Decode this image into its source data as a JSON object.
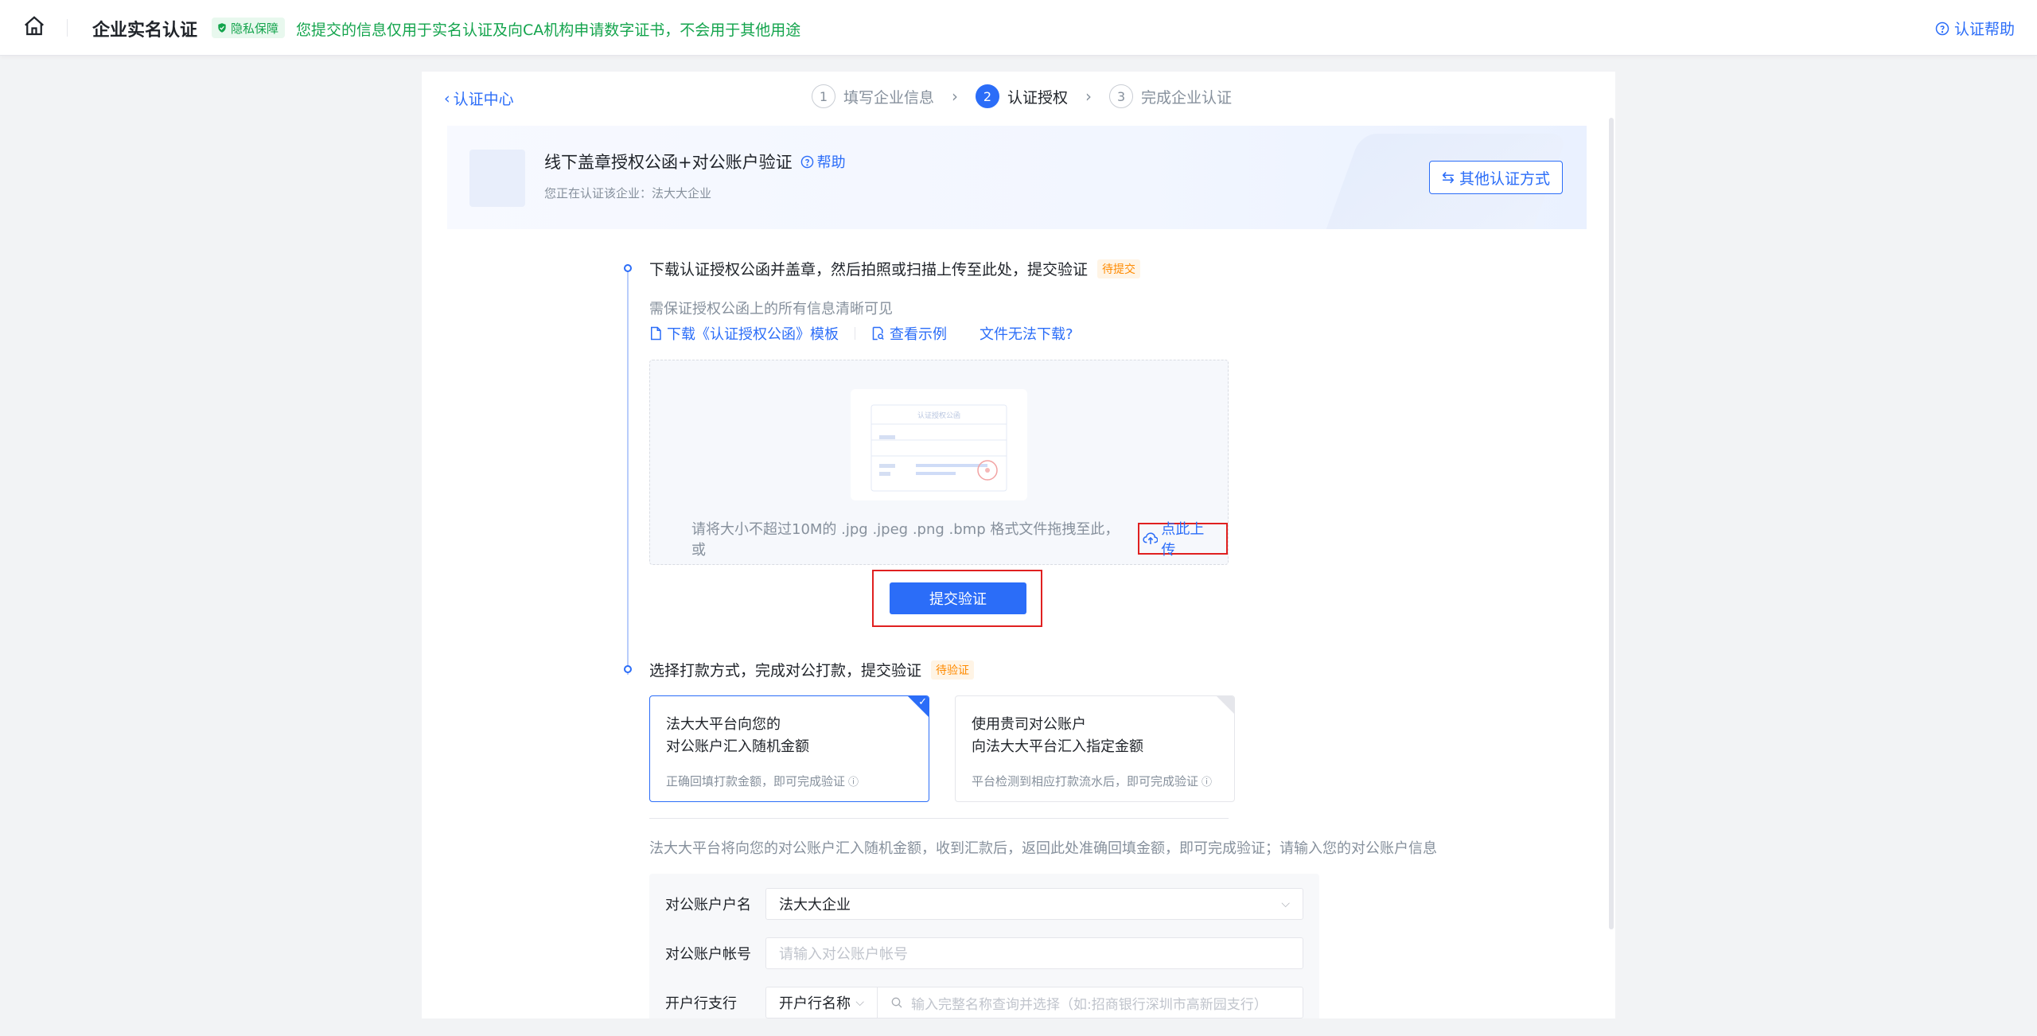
{
  "header": {
    "title": "企业实名认证",
    "privacy_badge": "隐私保障",
    "privacy_text": "您提交的信息仅用于实名认证及向CA机构申请数字证书，不会用于其他用途",
    "help_label": "认证帮助"
  },
  "nav": {
    "back_label": "认证中心",
    "steps": [
      {
        "num": "1",
        "label": "填写企业信息"
      },
      {
        "num": "2",
        "label": "认证授权"
      },
      {
        "num": "3",
        "label": "完成企业认证"
      }
    ]
  },
  "banner": {
    "title": "线下盖章授权公函+对公账户验证",
    "help_label": "帮助",
    "subtitle": "您正在认证该企业：法大大企业",
    "other_method_label": "其他认证方式"
  },
  "step1": {
    "title": "下载认证授权公函并盖章，然后拍照或扫描上传至此处，提交验证",
    "tag": "待提交",
    "hint": "需保证授权公函上的所有信息清晰可见",
    "link_download": "下载《认证授权公函》模板",
    "link_example": "查看示例",
    "link_cannot_download": "文件无法下载?",
    "doc_preview_title": "认证授权公函",
    "upload_tip": "请将大小不超过10M的 .jpg .jpeg .png .bmp 格式文件拖拽至此，或",
    "upload_label": "点此上传",
    "submit_label": "提交验证"
  },
  "step2": {
    "title": "选择打款方式，完成对公打款，提交验证",
    "tag": "待验证",
    "option_a": {
      "line1": "法大大平台向您的",
      "line2": "对公账户汇入随机金额",
      "sub": "正确回填打款金额，即可完成验证"
    },
    "option_b": {
      "line1": "使用贵司对公账户",
      "line2": "向法大大平台汇入指定金额",
      "sub": "平台检测到相应打款流水后，即可完成验证"
    },
    "description": "法大大平台将向您的对公账户汇入随机金额，收到汇款后，返回此处准确回填金额，即可完成验证；请输入您的对公账户信息",
    "form": {
      "account_name_label": "对公账户户名",
      "account_name_value": "法大大企业",
      "account_no_label": "对公账户帐号",
      "account_no_placeholder": "请输入对公账户帐号",
      "bank_label": "开户行支行",
      "bank_select_value": "开户行名称",
      "bank_search_placeholder": "输入完整名称查询并选择（如:招商银行深圳市高新园支行）"
    }
  },
  "colors": {
    "primary": "#2b6df8",
    "success": "#14a44d",
    "warning": "#ff8a00",
    "highlight": "#e02020"
  }
}
